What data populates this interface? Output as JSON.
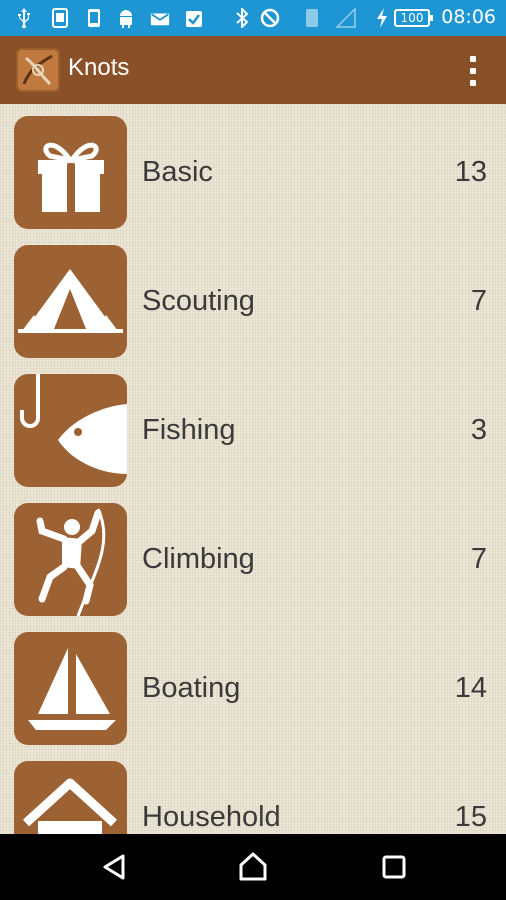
{
  "status_bar": {
    "time": "08:06",
    "battery": "100",
    "icons": [
      "usb-icon",
      "sim-icon",
      "phone-icon",
      "android-icon",
      "email-icon",
      "clipboard-check-icon",
      "bluetooth-icon",
      "no-signal-icon",
      "vibrate-icon",
      "signal-icon",
      "charging-icon"
    ]
  },
  "action_bar": {
    "title": "Knots",
    "menu_icon": "overflow-menu-icon"
  },
  "categories": [
    {
      "label": "Basic",
      "count": "13",
      "icon": "gift-icon"
    },
    {
      "label": "Scouting",
      "count": "7",
      "icon": "tent-icon"
    },
    {
      "label": "Fishing",
      "count": "3",
      "icon": "fish-hook-icon"
    },
    {
      "label": "Climbing",
      "count": "7",
      "icon": "climber-icon"
    },
    {
      "label": "Boating",
      "count": "14",
      "icon": "sailboat-icon"
    },
    {
      "label": "Household",
      "count": "15",
      "icon": "house-icon"
    }
  ],
  "nav_bar": {
    "icons": [
      "back-icon",
      "home-icon",
      "recents-icon"
    ]
  },
  "colors": {
    "status_bar": "#1d96d3",
    "action_bar": "#8a5128",
    "tile": "#9c6233",
    "background": "#ece6d7"
  }
}
